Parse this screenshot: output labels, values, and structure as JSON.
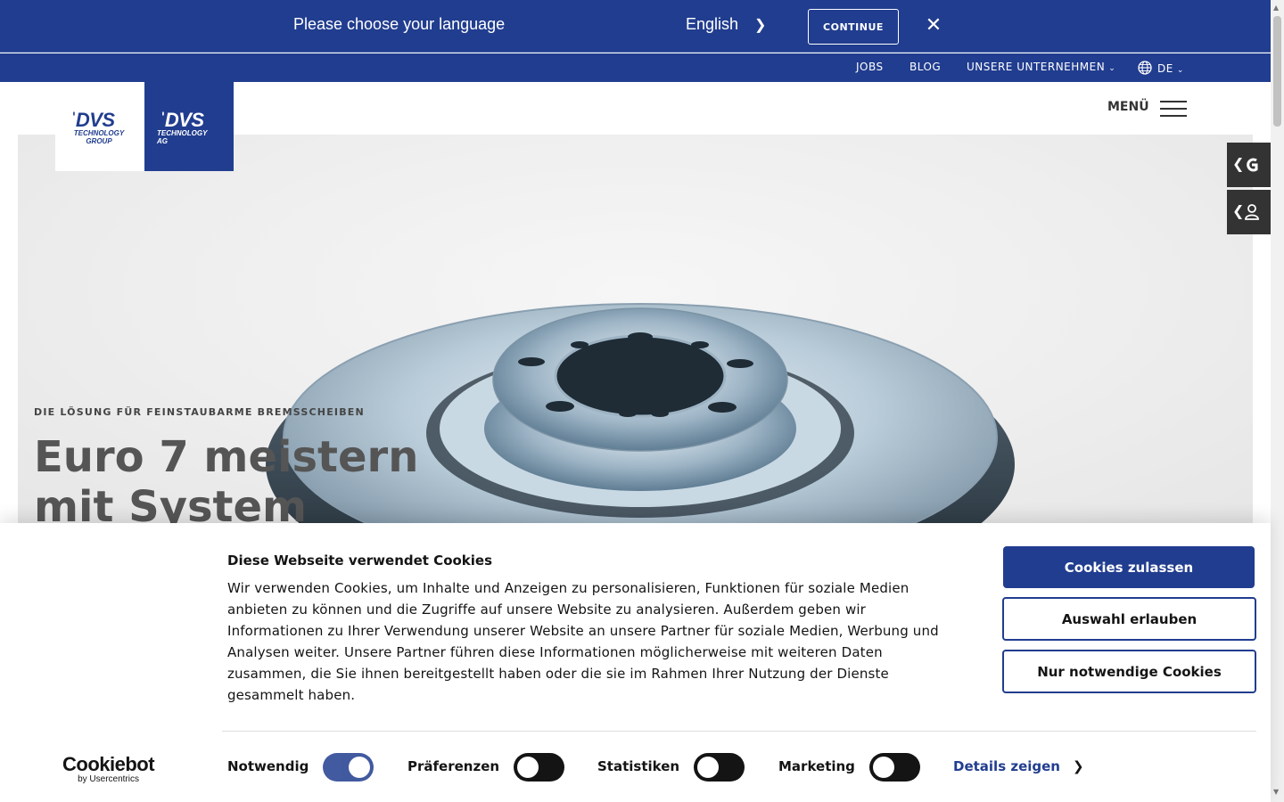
{
  "language_bar": {
    "prompt": "Please choose your language",
    "selected_language": "English",
    "continue_label": "CONTINUE",
    "close_icon": "close-icon",
    "background": "#213d8f"
  },
  "top_nav": {
    "items": [
      {
        "label": "JOBS"
      },
      {
        "label": "BLOG"
      },
      {
        "label": "UNSERE UNTERNEHMEN"
      }
    ],
    "language": "DE"
  },
  "header": {
    "logo_group": {
      "mark": "DVS",
      "sub": "TECHNOLOGY GROUP"
    },
    "logo_ag": {
      "mark": "DVS",
      "sub": "TECHNOLOGY AG"
    },
    "menu_label": "MENÜ"
  },
  "hero": {
    "eyebrow": "DIE LÖSUNG FÜR FEINSTAUBARME BREMSSCHEIBEN",
    "title": "Euro 7 meistern mit System",
    "image": "brake-disc"
  },
  "side_tabs": [
    {
      "icon": "dvs-logo-icon"
    },
    {
      "icon": "person-icon"
    }
  ],
  "cookie_banner": {
    "brand": "Cookiebot",
    "brand_sub": "by Usercentrics",
    "title": "Diese Webseite verwendet Cookies",
    "text": "Wir verwenden Cookies, um Inhalte und Anzeigen zu personalisieren, Funktionen für soziale Medien anbieten zu können und die Zugriffe auf unsere Website zu analysieren. Außerdem geben wir Informationen zu Ihrer Verwendung unserer Website an unsere Partner für soziale Medien, Werbung und Analysen weiter. Unsere Partner führen diese Informationen möglicherweise mit weiteren Daten zusammen, die Sie ihnen bereitgestellt haben oder die sie im Rahmen Ihrer Nutzung der Dienste gesammelt haben.",
    "buttons": {
      "allow_all": "Cookies zulassen",
      "allow_selection": "Auswahl erlauben",
      "necessary_only": "Nur notwendige Cookies"
    },
    "toggles": [
      {
        "label": "Notwendig",
        "on": true
      },
      {
        "label": "Präferenzen",
        "on": false
      },
      {
        "label": "Statistiken",
        "on": false
      },
      {
        "label": "Marketing",
        "on": false
      }
    ],
    "details_label": "Details zeigen",
    "accent": "#213d8f"
  }
}
